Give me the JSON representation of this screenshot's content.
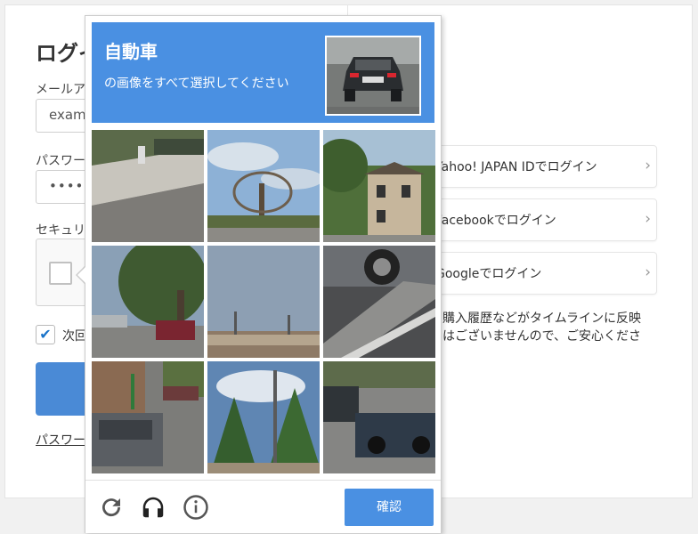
{
  "login": {
    "title": "ログイン",
    "email_label": "メールアドレス",
    "email_value": "example@",
    "password_label": "パスワード",
    "password_value": "••••••",
    "security_label": "セキュリティ認証",
    "remember_label": "次回から自動ログイン",
    "forgot_link": "パスワードを忘れた方"
  },
  "social": {
    "items": [
      {
        "label": "Yahoo! JAPAN IDでログイン",
        "icon": "yahoo-icon"
      },
      {
        "label": "Facebookでログイン",
        "icon": "facebook-icon"
      },
      {
        "label": "Googleでログイン",
        "icon": "google-icon"
      }
    ],
    "note_lines": [
      "・購入履歴などがタイムラインに反映",
      "とはございませんので、ご安心くださ"
    ]
  },
  "captcha": {
    "title": "自動車",
    "subtitle": "の画像をすべて選択してください",
    "tiles": [
      {
        "description": "street-wall-fence"
      },
      {
        "description": "bare-tree-sky"
      },
      {
        "description": "house-trees"
      },
      {
        "description": "tree-parked-car"
      },
      {
        "description": "sky-building"
      },
      {
        "description": "car-wheel-road"
      },
      {
        "description": "street-car-sidewalk"
      },
      {
        "description": "evergreen-trees"
      },
      {
        "description": "parked-cars-street"
      }
    ],
    "verify_label": "確認",
    "icons": [
      "reload-icon",
      "audio-icon",
      "info-icon"
    ]
  },
  "colors": {
    "captcha_blue": "#4a90e2",
    "submit_blue": "#4a8ad6"
  }
}
